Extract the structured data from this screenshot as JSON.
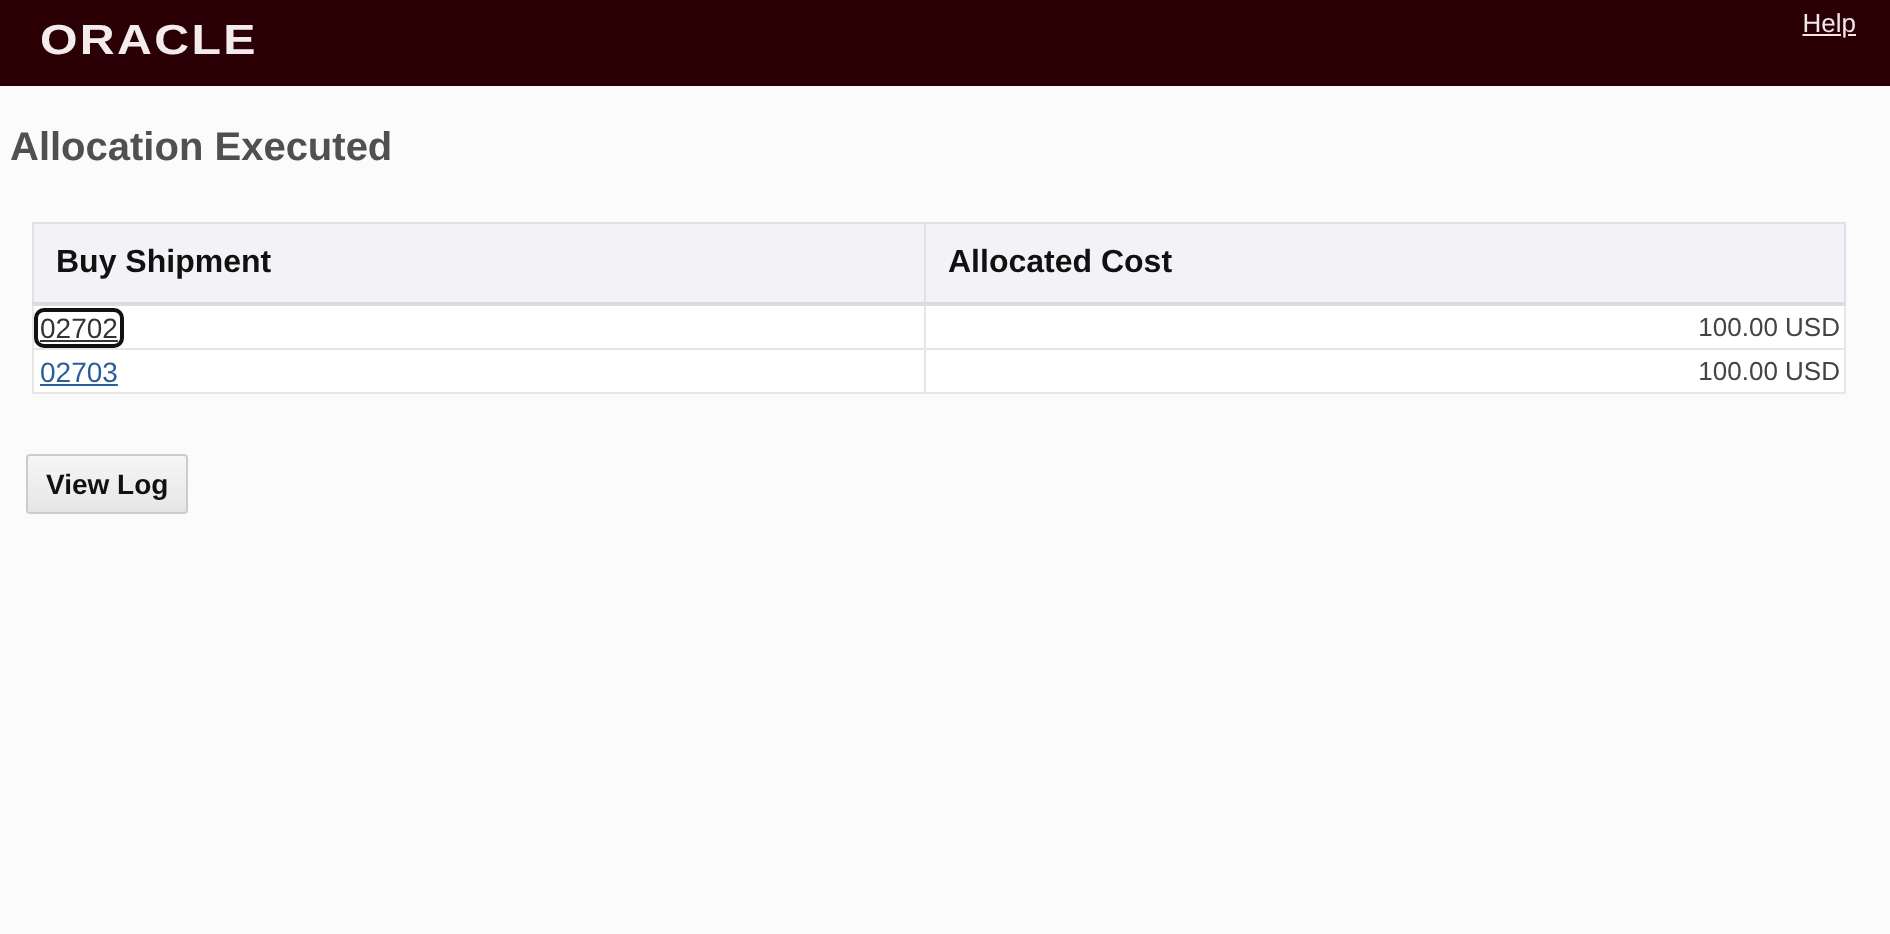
{
  "header": {
    "logo": "ORACLE",
    "help_link": "Help"
  },
  "page_title": "Allocation Executed",
  "table": {
    "columns": [
      "Buy Shipment",
      "Allocated Cost"
    ],
    "rows": [
      {
        "buy_shipment": "02702",
        "allocated_cost": "100.00 USD",
        "focused": true
      },
      {
        "buy_shipment": "02703",
        "allocated_cost": "100.00 USD",
        "focused": false
      }
    ]
  },
  "buttons": [
    "View Log"
  ]
}
